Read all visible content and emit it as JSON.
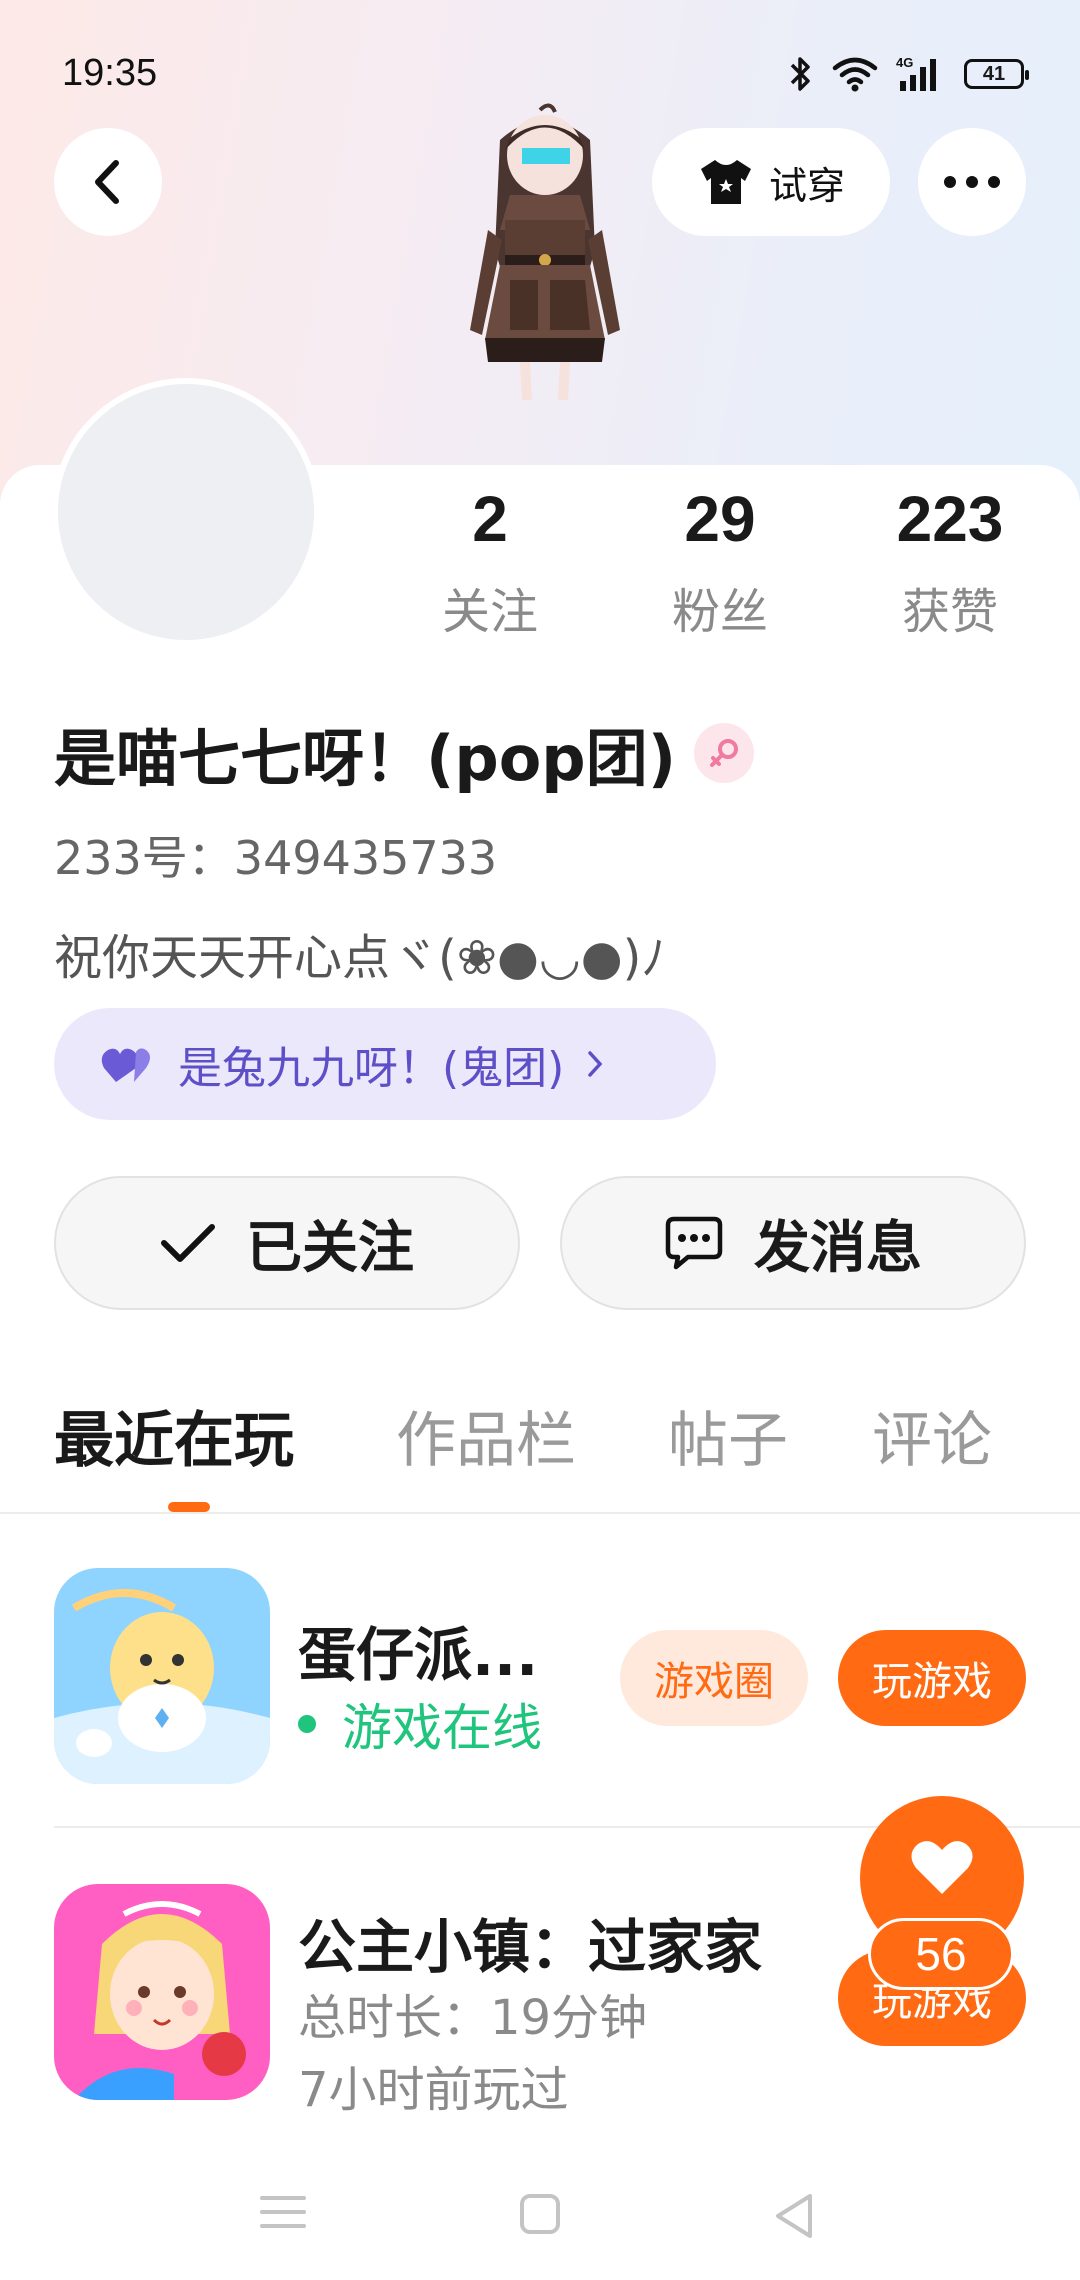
{
  "status_bar": {
    "time": "19:35",
    "battery": "41",
    "icons": [
      "bluetooth-icon",
      "wifi-icon",
      "4g-signal-icon",
      "battery-icon"
    ]
  },
  "header": {
    "try_on_label": "试穿"
  },
  "profile": {
    "stats": [
      {
        "value": "2",
        "label": "关注"
      },
      {
        "value": "29",
        "label": "粉丝"
      },
      {
        "value": "223",
        "label": "获赞"
      }
    ],
    "nickname": "是喵七七呀！(pop团)",
    "uid": "233号：349435733",
    "bio": "祝你天天开心点ヾ(❀●◡●)ﾉ",
    "relation": "是兔九九呀！(鬼团)"
  },
  "actions": {
    "follow_label": "已关注",
    "message_label": "发消息"
  },
  "tabs": [
    "最近在玩",
    "作品栏",
    "帖子",
    "评论"
  ],
  "games": [
    {
      "name": "蛋仔派...",
      "status": "游戏在线",
      "circle_label": "游戏圈",
      "play_label": "玩游戏"
    },
    {
      "name": "公主小镇：过家家",
      "duration": "总时长：19分钟",
      "last_played": "7小时前玩过",
      "play_label": "玩游戏"
    }
  ],
  "like": {
    "count": "56"
  },
  "colors": {
    "accent": "#ff6a13",
    "online": "#1fc47d",
    "relation_text": "#5d4fc7",
    "relation_bg": "#ece8fc"
  }
}
